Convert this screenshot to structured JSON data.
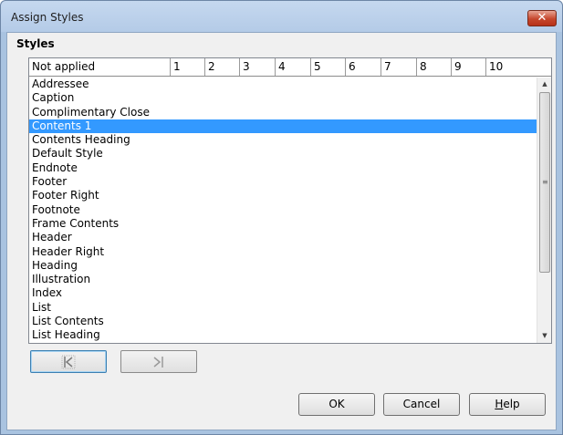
{
  "window": {
    "title": "Assign Styles",
    "close_label": "✕"
  },
  "section": {
    "label": "Styles"
  },
  "table": {
    "columns": [
      "Not applied",
      "1",
      "2",
      "3",
      "4",
      "5",
      "6",
      "7",
      "8",
      "9",
      "10"
    ],
    "rows": [
      "Addressee",
      "Caption",
      "Complimentary Close",
      "Contents 1",
      "Contents Heading",
      "Default Style",
      "Endnote",
      "Footer",
      "Footer Right",
      "Footnote",
      "Frame Contents",
      "Header",
      "Header Right",
      "Heading",
      "Illustration",
      "Index",
      "List",
      "List Contents",
      "List Heading"
    ],
    "selected_row": "Contents 1"
  },
  "nav": {
    "move_left_icon": "move-left-icon",
    "move_right_icon": "move-right-icon"
  },
  "buttons": {
    "ok": "OK",
    "cancel": "Cancel",
    "help_mnemonic": "H",
    "help_rest": "elp"
  },
  "colors": {
    "selection": "#3399ff",
    "close": "#c6472d"
  }
}
